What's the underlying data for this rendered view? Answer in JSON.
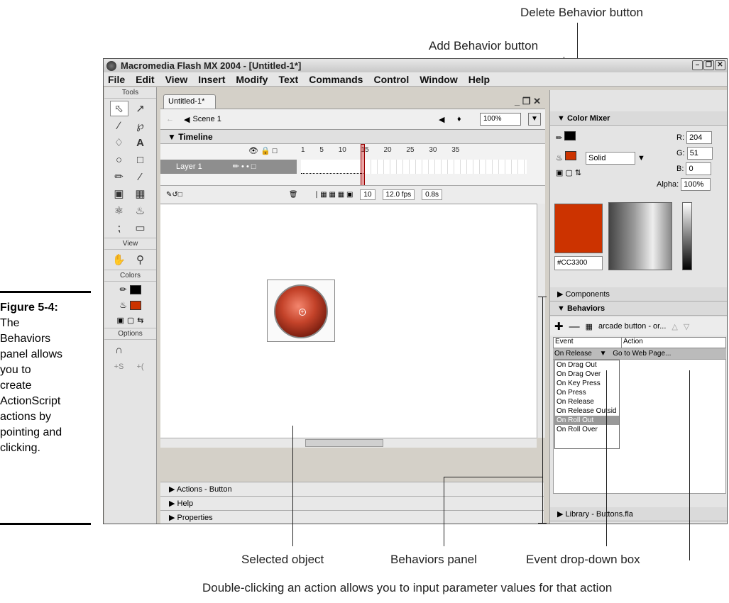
{
  "callouts": {
    "delete_behavior": "Delete Behavior button",
    "add_behavior": "Add Behavior button",
    "selected_object": "Selected object",
    "behaviors_panel": "Behaviors panel",
    "event_dropdown": "Event drop-down box",
    "double_click": "Double-clicking an action allows you to input parameter values for that action"
  },
  "figure": {
    "label": "Figure 5-4:",
    "caption_lines": [
      "The",
      "Behaviors",
      "panel allows",
      "you to",
      "create",
      "ActionScript",
      "actions by",
      "pointing and",
      "clicking."
    ]
  },
  "window": {
    "title": "Macromedia Flash MX 2004 - [Untitled-1*]",
    "menu": [
      "File",
      "Edit",
      "View",
      "Insert",
      "Modify",
      "Text",
      "Commands",
      "Control",
      "Window",
      "Help"
    ]
  },
  "tools": {
    "header": "Tools",
    "view_label": "View",
    "colors_label": "Colors",
    "options_label": "Options"
  },
  "document": {
    "tab": "Untitled-1*",
    "scene": "Scene 1",
    "zoom": "100%",
    "timeline_label": "Timeline",
    "frame_numbers": [
      "1",
      "5",
      "10",
      "15",
      "20",
      "25",
      "30",
      "35"
    ],
    "layer": "Layer 1",
    "current_frame": "10",
    "fps": "12.0 fps",
    "time": "0.8s",
    "panels": [
      "Actions - Button",
      "Help",
      "Properties"
    ]
  },
  "color_mixer": {
    "title": "Color Mixer",
    "fill_type": "Solid",
    "r_label": "R:",
    "r": "204",
    "g_label": "G:",
    "g": "51",
    "b_label": "B:",
    "b": "0",
    "alpha_label": "Alpha:",
    "alpha": "100%",
    "hex": "#CC3300",
    "color": "#cc3300"
  },
  "components": {
    "title": "Components"
  },
  "behaviors": {
    "title": "Behaviors",
    "target": "arcade button - or...",
    "col_event": "Event",
    "col_action": "Action",
    "row_event": "On Release",
    "row_action": "Go to Web Page...",
    "options": [
      "On Drag Out",
      "On Drag Over",
      "On Key Press",
      "On Press",
      "On Release",
      "On Release Outsid",
      "On Roll Out",
      "On Roll Over"
    ]
  },
  "library": {
    "title": "Library - Buttons.fla"
  }
}
